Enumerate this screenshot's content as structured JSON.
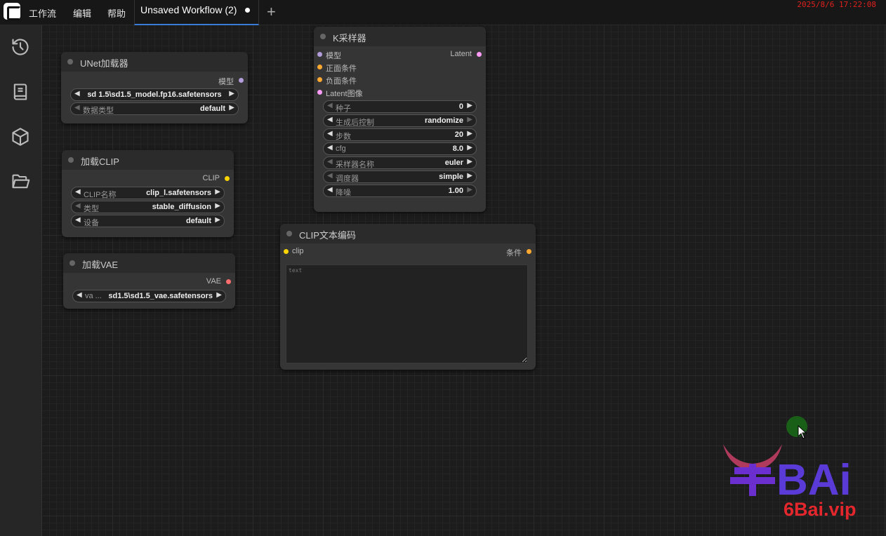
{
  "topbar": {
    "menu": [
      "工作流",
      "编辑",
      "帮助"
    ],
    "tab_label": "Unsaved Workflow (2)",
    "add_tab_symbol": "+",
    "clock": "2025/8/6 17:22:08"
  },
  "sidebar": {
    "items": [
      "history-icon",
      "library-icon",
      "model-cube-icon",
      "folder-icon"
    ]
  },
  "nodes": {
    "unet": {
      "title": "UNet加载器",
      "output": "模型",
      "widgets": [
        {
          "label": "",
          "value": "sd 1.5\\sd1.5_model.fp16.safetensors"
        },
        {
          "label": "数据类型",
          "value": "default"
        }
      ]
    },
    "clip_loader": {
      "title": "加载CLIP",
      "output": "CLIP",
      "widgets": [
        {
          "label": "CLIP名称",
          "value": "clip_l.safetensors"
        },
        {
          "label": "类型",
          "value": "stable_diffusion"
        },
        {
          "label": "设备",
          "value": "default"
        }
      ]
    },
    "vae_loader": {
      "title": "加载VAE",
      "output": "VAE",
      "widgets": [
        {
          "label": "va ...",
          "value": "sd1.5\\sd1.5_vae.safetensors"
        }
      ]
    },
    "ksampler": {
      "title": "K采样器",
      "output": "Latent",
      "inputs": [
        "模型",
        "正面条件",
        "负面条件",
        "Latent图像"
      ],
      "widgets": [
        {
          "label": "种子",
          "value": "0"
        },
        {
          "label": "生成后控制",
          "value": "randomize"
        },
        {
          "label": "步数",
          "value": "20"
        },
        {
          "label": "cfg",
          "value": "8.0"
        },
        {
          "label": "采样器名称",
          "value": "euler"
        },
        {
          "label": "调度器",
          "value": "simple"
        },
        {
          "label": "降噪",
          "value": "1.00"
        }
      ]
    },
    "clip_text": {
      "title": "CLIP文本编码",
      "input": "clip",
      "output": "条件",
      "textarea_placeholder": "text"
    }
  },
  "watermark": {
    "text": "6Bai.vip",
    "logo_text": "BAi"
  },
  "colors": {
    "model": "#b39ddb",
    "clip": "#ffd500",
    "vae": "#ff6e6e",
    "conditioning": "#ffa931",
    "latent": "#ff9cf9",
    "tab_accent": "#3a7bd5",
    "clock": "#e0201c"
  }
}
